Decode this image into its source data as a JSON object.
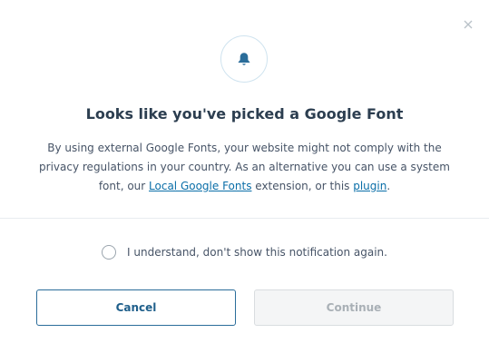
{
  "dialog": {
    "close_icon": "close-icon",
    "bell_icon": "bell-icon",
    "title": "Looks like you've picked a Google Font",
    "description": {
      "text_before_link1": "By using external Google Fonts, your website might not comply with the privacy regulations in your country. As an alternative you can use a system font, our ",
      "link1": "Local Google Fonts",
      "text_between": " extension, or this ",
      "link2": "plugin",
      "text_after": "."
    },
    "checkbox_label": "I understand, don't show this notification again.",
    "checkbox_checked": false,
    "cancel_label": "Cancel",
    "continue_label": "Continue",
    "continue_enabled": false
  },
  "colors": {
    "accent": "#1f5f8b",
    "link": "#0a6ea8",
    "title": "#2c3e50",
    "body_text": "#475467",
    "disabled_text": "#a9b0b6"
  }
}
